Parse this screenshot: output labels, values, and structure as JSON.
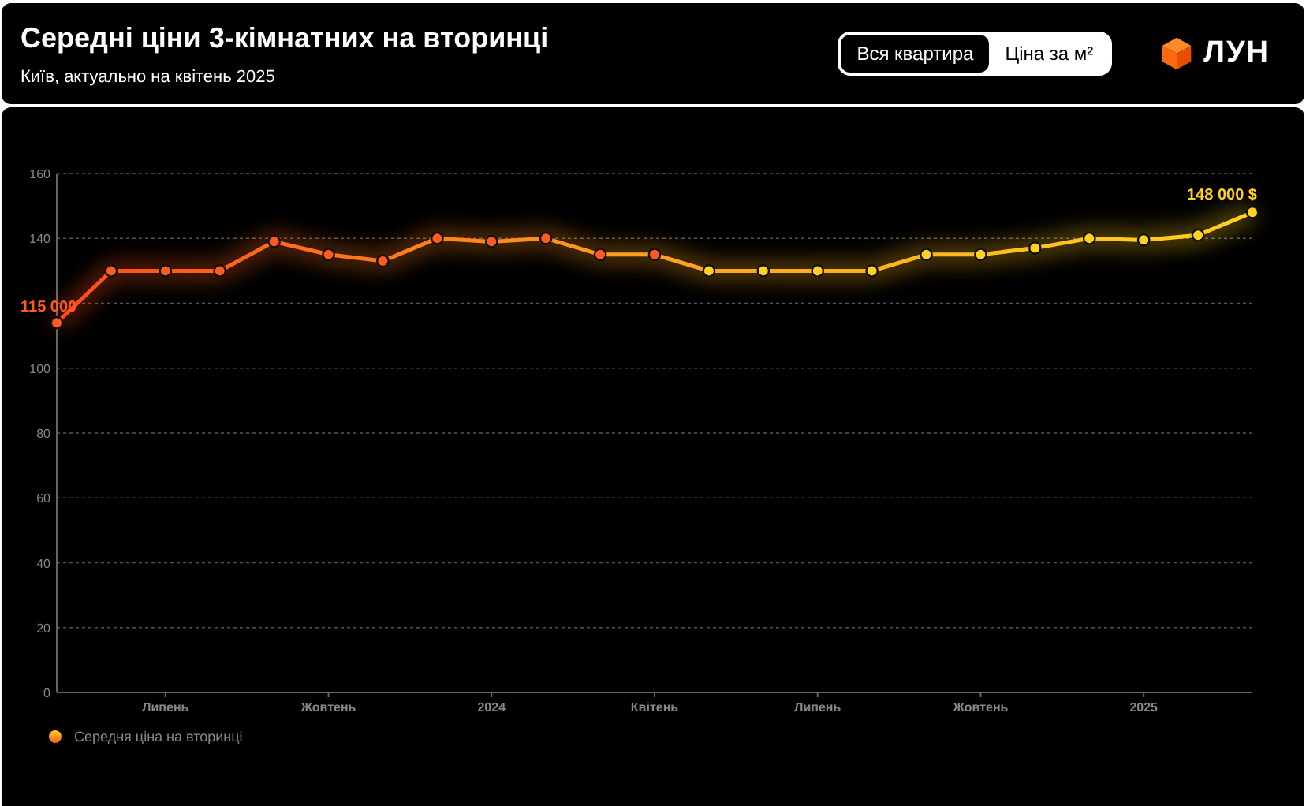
{
  "header": {
    "title": "Середні ціни 3-кімнатних на вторинці",
    "subtitle": "Київ, актуально на квітень 2025",
    "toggle": [
      {
        "label": "Вся квартира",
        "selected": true
      },
      {
        "label": "Ціна за м²",
        "selected": false
      }
    ],
    "logo": "ЛУН"
  },
  "chart": {
    "chart_data": {
      "type": "line",
      "categories": [
        null,
        null,
        "Липень",
        null,
        null,
        "Жовтень",
        null,
        null,
        "2024",
        null,
        null,
        "Квітень",
        null,
        null,
        "Липень",
        null,
        null,
        "Жовтень",
        null,
        null,
        "2025",
        null,
        null
      ],
      "grid": true,
      "series": [
        {
          "name": "Середня ціна на вторинці",
          "color": "#ffd21f",
          "marker": "circle",
          "values": [
            114,
            130,
            130,
            130,
            139,
            135,
            133,
            140,
            139,
            140,
            135,
            135,
            130,
            130,
            130,
            130,
            135,
            135,
            137,
            140,
            139.5,
            141,
            148
          ]
        }
      ],
      "ylim": [
        0,
        160
      ],
      "yticks": [
        0,
        20,
        40,
        60,
        80,
        100,
        140,
        160
      ],
      "annotations": [
        {
          "y": 114,
          "text": "115 000"
        },
        {
          "y": 148,
          "text": "148 000 $"
        }
      ]
    }
  }
}
